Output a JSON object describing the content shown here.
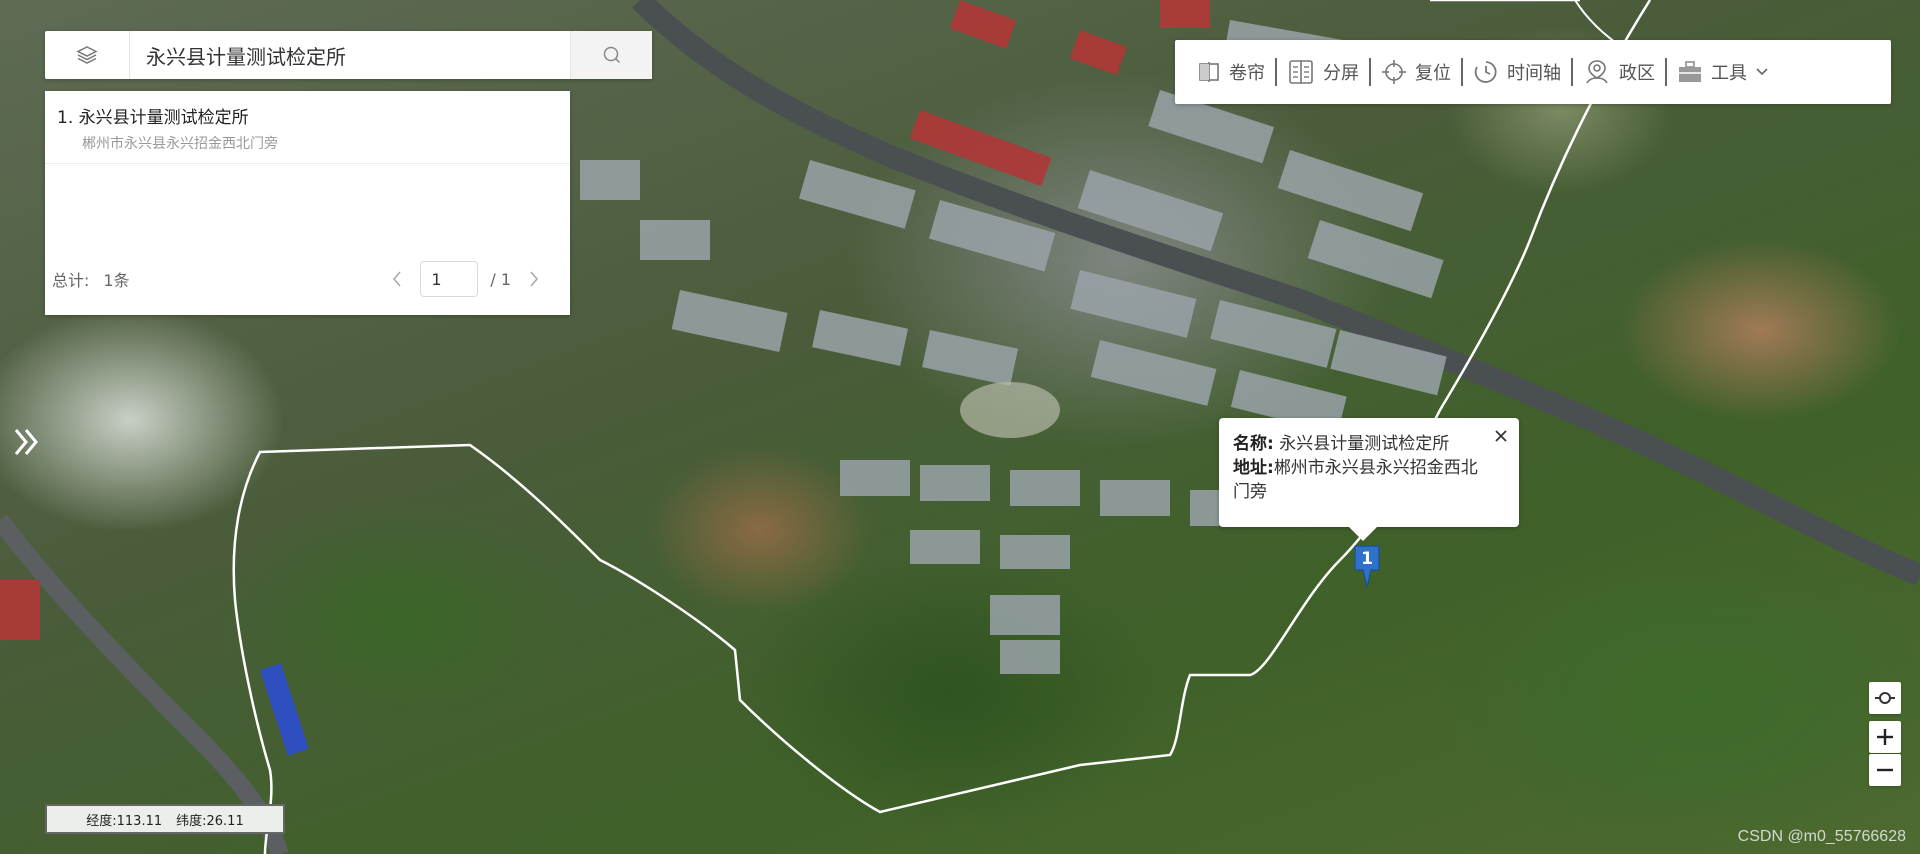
{
  "search": {
    "query": "永兴县计量测试检定所"
  },
  "results": {
    "items": [
      {
        "title": "1. 永兴县计量测试检定所",
        "address": "郴州市永兴县永兴招金西北门旁"
      }
    ],
    "total_label": "总计:",
    "total_value": "1条",
    "current_page": "1",
    "page_total": "/ 1"
  },
  "toolbar": {
    "items": [
      {
        "label": "卷帘",
        "icon": "swipe-icon"
      },
      {
        "label": "分屏",
        "icon": "split-screen-icon"
      },
      {
        "label": "复位",
        "icon": "crosshair-icon"
      },
      {
        "label": "时间轴",
        "icon": "clock-icon"
      },
      {
        "label": "政区",
        "icon": "location-person-icon"
      },
      {
        "label": "工具",
        "icon": "toolbox-icon"
      }
    ]
  },
  "popup": {
    "name_key": "名称:",
    "name_value": "永兴县计量测试检定所",
    "address_key": "地址:",
    "address_value": "郴州市永兴县永兴招金西北门旁"
  },
  "marker": {
    "label": "1",
    "color": "#2d72c8"
  },
  "coords": {
    "lon": "经度:113.11",
    "lat": "纬度:26.11"
  },
  "watermark": "CSDN @m0_55766628",
  "colors": {
    "boundary": "#ffffff",
    "marker": "#2d72c8",
    "panel": "#ffffff"
  }
}
